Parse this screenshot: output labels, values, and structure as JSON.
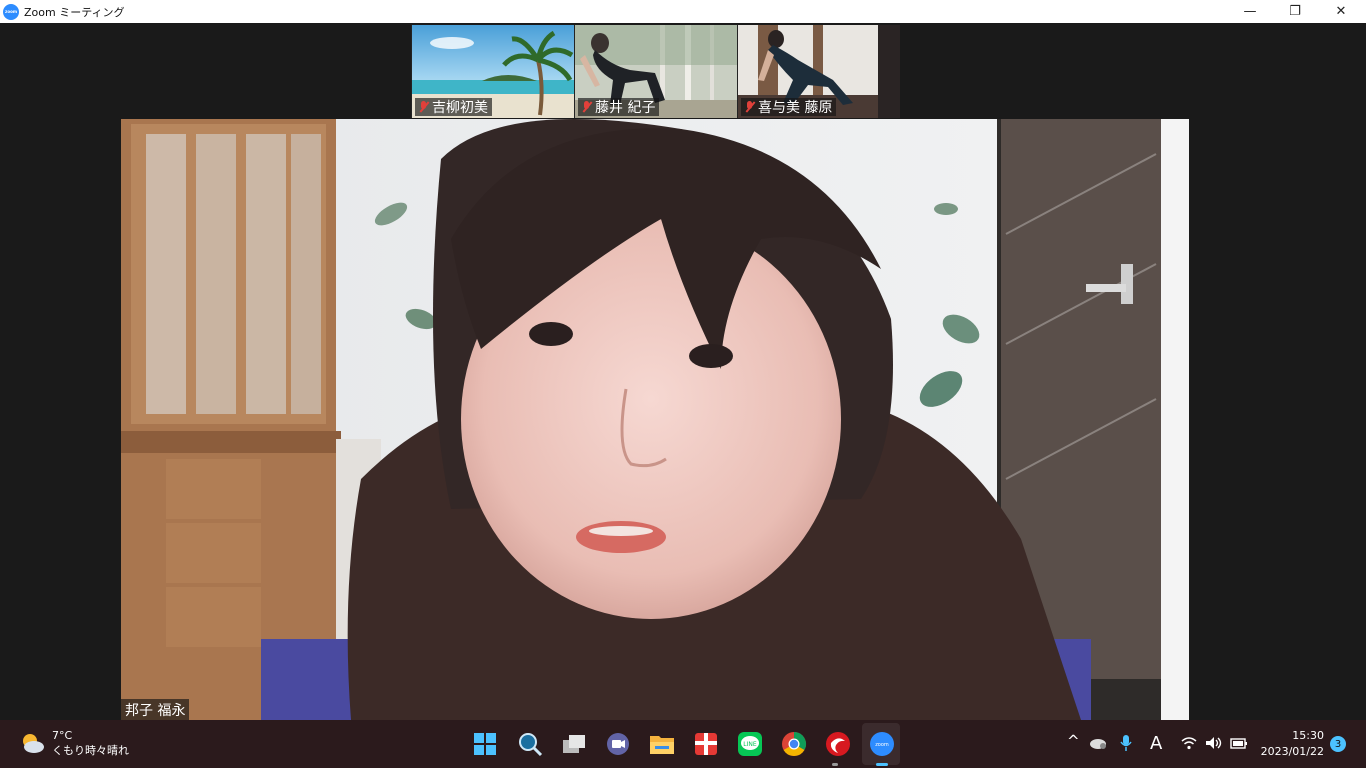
{
  "window": {
    "title": "Zoom ミーティング",
    "logo_text": "zoom",
    "minimize_glyph": "—",
    "maximize_glyph": "❐",
    "close_glyph": "✕"
  },
  "participants": [
    {
      "name": "吉柳初美",
      "muted": true
    },
    {
      "name": "藤井 紀子",
      "muted": true
    },
    {
      "name": "喜与美 藤原",
      "muted": true
    }
  ],
  "active_speaker": {
    "name": "邦子 福永"
  },
  "taskbar": {
    "weather": {
      "temp": "7°C",
      "condition": "くもり時々晴れ"
    },
    "apps": [
      {
        "icon": "windows-start-icon"
      },
      {
        "icon": "search-icon"
      },
      {
        "icon": "task-view-icon"
      },
      {
        "icon": "teams-chat-icon"
      },
      {
        "icon": "file-explorer-icon"
      },
      {
        "icon": "gift-app-icon"
      },
      {
        "icon": "line-app-icon",
        "label": "LINE"
      },
      {
        "icon": "chrome-icon"
      },
      {
        "icon": "trend-micro-icon"
      },
      {
        "icon": "zoom-app-icon",
        "label": "zoom",
        "active": true
      }
    ],
    "tray": {
      "chevron": "^",
      "ime": "A",
      "time": "15:30",
      "date": "2023/01/22",
      "notifications": "3"
    }
  },
  "colors": {
    "accent": "#2d8cff",
    "taskbar": "#2b1a1c",
    "muted": "#e0403a"
  }
}
